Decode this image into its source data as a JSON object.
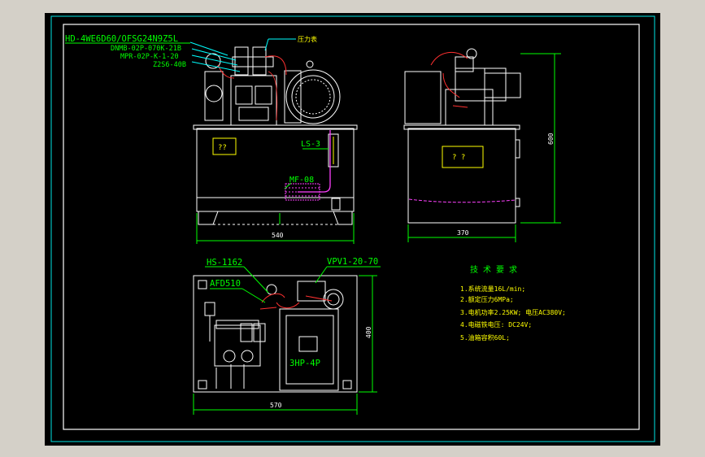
{
  "colors": {
    "background": "#d4d0c8",
    "paper": "#000000",
    "white": "#ffffff",
    "frame": "#00e5e5",
    "green": "#00ff00",
    "yellow": "#ffff00",
    "cyan": "#00ffff",
    "red": "#ff3030",
    "magenta": "#ff40ff"
  },
  "front_view": {
    "valve_model": "HD-4WE6D60/OFSG24N9Z5L",
    "part_labels": [
      "DNMB-02P-070K-21B",
      "MPR-02P-K-1-20",
      "Z2S6-40B"
    ],
    "gauge_label": "压力表",
    "tank_tag": "??",
    "level_gauge": "LS-3",
    "filter": "MF-08",
    "width_dim": "540"
  },
  "side_view": {
    "tank_tag": "? ?",
    "width_dim": "370",
    "height_dim": "600"
  },
  "top_view": {
    "valve_label": "HS-1162",
    "pump_label": "VPV1-20-70",
    "breather_label": "AFD510",
    "motor_label": "3HP-4P",
    "width_dim": "570",
    "depth_dim": "400"
  },
  "requirements": {
    "title": "技 术 要 求",
    "items": [
      "1.系统流量16L/min;",
      "2.额定压力6MPa;",
      "3.电机功率2.25KW; 电压AC380V;",
      "4.电磁铁电压: DC24V;",
      "5.油箱容积60L;"
    ]
  }
}
